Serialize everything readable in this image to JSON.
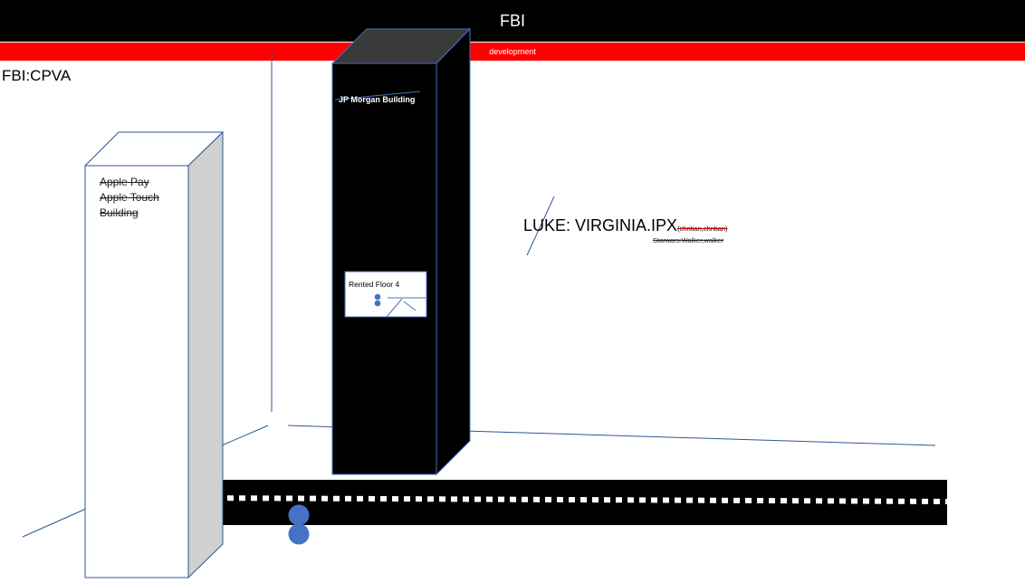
{
  "header": {
    "title": "FBI",
    "subtitle": "development"
  },
  "corner_label": "FBI:CPVA",
  "buildings": {
    "apple": {
      "lines": [
        "Apple Pay",
        "Apple Touch",
        "Building"
      ]
    },
    "jp": {
      "label": "JP Morgan  Building"
    }
  },
  "floor_box": {
    "label": "Rented Floor 4"
  },
  "luke": {
    "label": "LUKE: VIRGINIA.IPX",
    "sub": "(chritian,chritian)",
    "starwars": "Starwars:Walker,walker"
  },
  "colors": {
    "header_bg": "#000000",
    "red_bar": "#ff0000",
    "accent_blue": "#4472c4",
    "line_blue": "#2f5597"
  }
}
